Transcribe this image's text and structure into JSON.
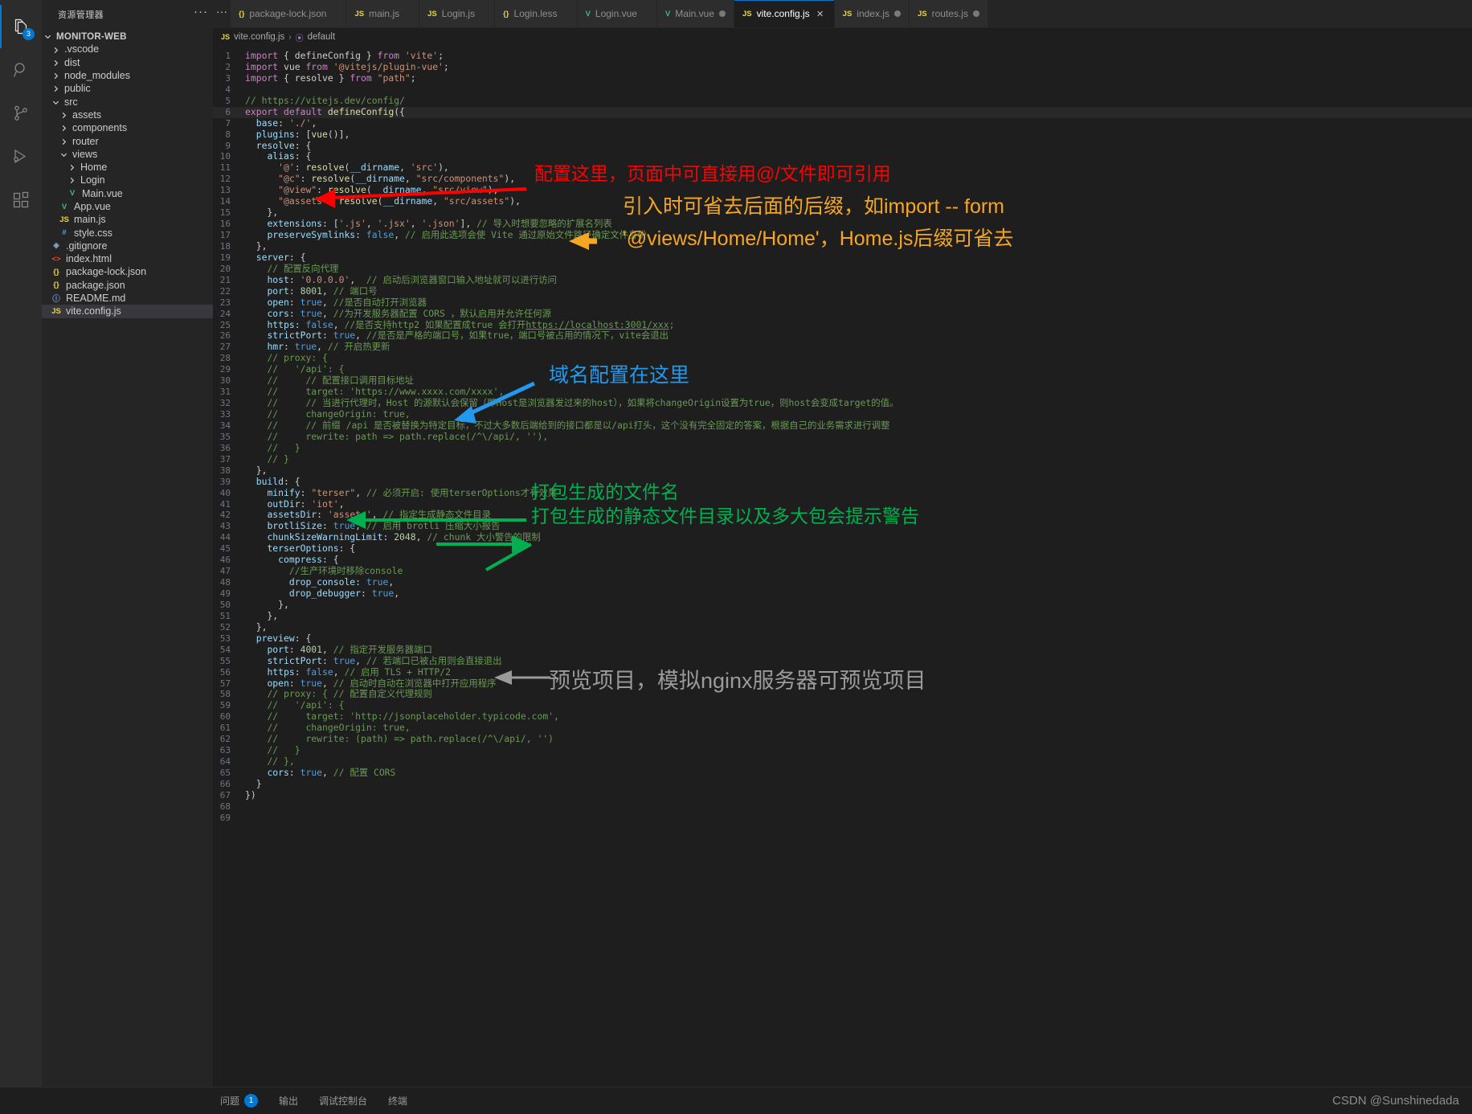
{
  "activitybar": {
    "items": [
      {
        "name": "explorer",
        "icon": "files-icon",
        "badge": "3",
        "active": true
      },
      {
        "name": "search",
        "icon": "search-icon",
        "badge": "",
        "active": false
      },
      {
        "name": "source-control",
        "icon": "source-control-icon",
        "badge": "",
        "active": false
      },
      {
        "name": "run-and-debug",
        "icon": "run-debug-icon",
        "badge": "",
        "active": false
      },
      {
        "name": "extensions",
        "icon": "extensions-icon",
        "badge": "",
        "active": false
      }
    ]
  },
  "sidebar": {
    "title": "资源管理器",
    "more_label": "···",
    "root": "MONITOR-WEB",
    "tree": [
      {
        "label": ".vscode",
        "indent": 1,
        "type": "folder",
        "open": false
      },
      {
        "label": "dist",
        "indent": 1,
        "type": "folder",
        "open": false
      },
      {
        "label": "node_modules",
        "indent": 1,
        "type": "folder",
        "open": false
      },
      {
        "label": "public",
        "indent": 1,
        "type": "folder",
        "open": false
      },
      {
        "label": "src",
        "indent": 1,
        "type": "folder",
        "open": true
      },
      {
        "label": "assets",
        "indent": 2,
        "type": "folder",
        "open": false
      },
      {
        "label": "components",
        "indent": 2,
        "type": "folder",
        "open": false
      },
      {
        "label": "router",
        "indent": 2,
        "type": "folder",
        "open": false
      },
      {
        "label": "views",
        "indent": 2,
        "type": "folder",
        "open": true
      },
      {
        "label": "Home",
        "indent": 3,
        "type": "folder",
        "open": false
      },
      {
        "label": "Login",
        "indent": 3,
        "type": "folder",
        "open": false
      },
      {
        "label": "Main.vue",
        "indent": 3,
        "type": "vue"
      },
      {
        "label": "App.vue",
        "indent": 2,
        "type": "vue"
      },
      {
        "label": "main.js",
        "indent": 2,
        "type": "js"
      },
      {
        "label": "style.css",
        "indent": 2,
        "type": "css"
      },
      {
        "label": ".gitignore",
        "indent": 1,
        "type": "git"
      },
      {
        "label": "index.html",
        "indent": 1,
        "type": "html"
      },
      {
        "label": "package-lock.json",
        "indent": 1,
        "type": "json"
      },
      {
        "label": "package.json",
        "indent": 1,
        "type": "json"
      },
      {
        "label": "README.md",
        "indent": 1,
        "type": "md"
      },
      {
        "label": "vite.config.js",
        "indent": 1,
        "type": "js",
        "selected": true
      }
    ]
  },
  "tabs": [
    {
      "label": "package-lock.json",
      "type": "json",
      "active": false,
      "dirty": false,
      "closeable": false
    },
    {
      "label": "main.js",
      "type": "js",
      "active": false,
      "dirty": false,
      "closeable": false
    },
    {
      "label": "Login.js",
      "type": "js",
      "active": false,
      "dirty": false,
      "closeable": false
    },
    {
      "label": "Login.less",
      "type": "json",
      "active": false,
      "dirty": false,
      "closeable": false
    },
    {
      "label": "Login.vue",
      "type": "vue",
      "active": false,
      "dirty": false,
      "closeable": false
    },
    {
      "label": "Main.vue",
      "type": "vue",
      "active": false,
      "dirty": true,
      "closeable": false
    },
    {
      "label": "vite.config.js",
      "type": "js",
      "active": true,
      "dirty": false,
      "closeable": true
    },
    {
      "label": "index.js",
      "type": "js",
      "active": false,
      "dirty": true,
      "closeable": false
    },
    {
      "label": "routes.js",
      "type": "js",
      "active": false,
      "dirty": true,
      "closeable": false
    }
  ],
  "breadcrumb": {
    "file": "vite.config.js",
    "separator": "›",
    "symbol": "default"
  },
  "editor": {
    "filename": "vite.config.js",
    "cursor_line": 6,
    "total_lines": 69,
    "lines": [
      {
        "n": 1,
        "text": "import { defineConfig } from 'vite';"
      },
      {
        "n": 2,
        "text": "import vue from '@vitejs/plugin-vue';"
      },
      {
        "n": 3,
        "text": "import { resolve } from \"path\";"
      },
      {
        "n": 4,
        "text": ""
      },
      {
        "n": 5,
        "text": "// https://vitejs.dev/config/"
      },
      {
        "n": 6,
        "text": "export default defineConfig({"
      },
      {
        "n": 7,
        "text": "  base: './',"
      },
      {
        "n": 8,
        "text": "  plugins: [vue()],"
      },
      {
        "n": 9,
        "text": "  resolve: {"
      },
      {
        "n": 10,
        "text": "    alias: {"
      },
      {
        "n": 11,
        "text": "      '@': resolve(__dirname, 'src'),"
      },
      {
        "n": 12,
        "text": "      \"@c\": resolve(__dirname, \"src/components\"),"
      },
      {
        "n": 13,
        "text": "      \"@view\": resolve(__dirname, \"src/view\"),"
      },
      {
        "n": 14,
        "text": "      \"@assets\": resolve(__dirname, \"src/assets\"),"
      },
      {
        "n": 15,
        "text": "    },"
      },
      {
        "n": 16,
        "text": "    extensions: ['.js', '.jsx', '.json'], // 导入时想要忽略的扩展名列表"
      },
      {
        "n": 17,
        "text": "    preserveSymlinks: false, // 启用此选项会使 Vite 通过原始文件路径确定文件身份"
      },
      {
        "n": 18,
        "text": "  },"
      },
      {
        "n": 19,
        "text": "  server: {"
      },
      {
        "n": 20,
        "text": "    // 配置反向代理"
      },
      {
        "n": 21,
        "text": "    host: '0.0.0.0',  // 启动后浏览器窗口输入地址就可以进行访问"
      },
      {
        "n": 22,
        "text": "    port: 8001, // 端口号"
      },
      {
        "n": 23,
        "text": "    open: true, //是否自动打开浏览器"
      },
      {
        "n": 24,
        "text": "    cors: true, //为开发服务器配置 CORS ，默认启用并允许任何源"
      },
      {
        "n": 25,
        "text": "    https: false, //是否支持http2 如果配置成true 会打开https://localhost:3001/xxx;"
      },
      {
        "n": 26,
        "text": "    strictPort: true, //是否是严格的端口号，如果true，端口号被占用的情况下，vite会退出"
      },
      {
        "n": 27,
        "text": "    hmr: true, // 开启热更新"
      },
      {
        "n": 28,
        "text": "    // proxy: {"
      },
      {
        "n": 29,
        "text": "    //   '/api': {"
      },
      {
        "n": 30,
        "text": "    //     // 配置接口调用目标地址"
      },
      {
        "n": 31,
        "text": "    //     target: 'https://www.xxxx.com/xxxx',"
      },
      {
        "n": 32,
        "text": "    //     // 当进行代理时，Host 的源默认会保留（即Host是浏览器发过来的host），如果将changeOrigin设置为true，则host会变成target的值。"
      },
      {
        "n": 33,
        "text": "    //     changeOrigin: true,"
      },
      {
        "n": 34,
        "text": "    //     // 前缀 /api 是否被替换为特定目标，不过大多数后端给到的接口都是以/api打头，这个没有完全固定的答案，根据自己的业务需求进行调整"
      },
      {
        "n": 35,
        "text": "    //     rewrite: path => path.replace(/^\\/api/, ''),"
      },
      {
        "n": 36,
        "text": "    //   }"
      },
      {
        "n": 37,
        "text": "    // }"
      },
      {
        "n": 38,
        "text": "  },"
      },
      {
        "n": 39,
        "text": "  build: {"
      },
      {
        "n": 40,
        "text": "    minify: \"terser\", // 必须开启: 使用terserOptions才有效果"
      },
      {
        "n": 41,
        "text": "    outDir: 'iot',"
      },
      {
        "n": 42,
        "text": "    assetsDir: 'assets', // 指定生成静态文件目录"
      },
      {
        "n": 43,
        "text": "    brotliSize: true, // 启用 brotli 压缩大小报告"
      },
      {
        "n": 44,
        "text": "    chunkSizeWarningLimit: 2048, // chunk 大小警告的限制"
      },
      {
        "n": 45,
        "text": "    terserOptions: {"
      },
      {
        "n": 46,
        "text": "      compress: {"
      },
      {
        "n": 47,
        "text": "        //生产环境时移除console"
      },
      {
        "n": 48,
        "text": "        drop_console: true,"
      },
      {
        "n": 49,
        "text": "        drop_debugger: true,"
      },
      {
        "n": 50,
        "text": "      },"
      },
      {
        "n": 51,
        "text": "    },"
      },
      {
        "n": 52,
        "text": "  },"
      },
      {
        "n": 53,
        "text": "  preview: {"
      },
      {
        "n": 54,
        "text": "    port: 4001, // 指定开发服务器端口"
      },
      {
        "n": 55,
        "text": "    strictPort: true, // 若端口已被占用则会直接退出"
      },
      {
        "n": 56,
        "text": "    https: false, // 启用 TLS + HTTP/2"
      },
      {
        "n": 57,
        "text": "    open: true, // 启动时自动在浏览器中打开应用程序"
      },
      {
        "n": 58,
        "text": "    // proxy: { // 配置自定义代理规则"
      },
      {
        "n": 59,
        "text": "    //   '/api': {"
      },
      {
        "n": 60,
        "text": "    //     target: 'http://jsonplaceholder.typicode.com',"
      },
      {
        "n": 61,
        "text": "    //     changeOrigin: true,"
      },
      {
        "n": 62,
        "text": "    //     rewrite: (path) => path.replace(/^\\/api/, '')"
      },
      {
        "n": 63,
        "text": "    //   }"
      },
      {
        "n": 64,
        "text": "    // },"
      },
      {
        "n": 65,
        "text": "    cors: true, // 配置 CORS"
      },
      {
        "n": 66,
        "text": "  }"
      },
      {
        "n": 67,
        "text": "})"
      },
      {
        "n": 68,
        "text": ""
      },
      {
        "n": 69,
        "text": ""
      }
    ]
  },
  "annotations": [
    {
      "id": "anno-alias",
      "color": "#ff0000",
      "text": "配置这里，页面中可直接用@/文件即可引用"
    },
    {
      "id": "anno-ext-1",
      "color": "#f5a623",
      "text": "引入时可省去后面的后缀，如import -- form"
    },
    {
      "id": "anno-ext-2",
      "color": "#f5a623",
      "text": "'@views/Home/Home'，Home.js后缀可省去"
    },
    {
      "id": "anno-proxy",
      "color": "#2299ee",
      "text": "域名配置在这里"
    },
    {
      "id": "anno-outdir",
      "color": "#00b050",
      "text": "打包生成的文件名"
    },
    {
      "id": "anno-assets",
      "color": "#00b050",
      "text": "打包生成的静态文件目录以及多大包会提示警告"
    },
    {
      "id": "anno-preview",
      "color": "#9a9a9a",
      "text": "预览项目，模拟nginx服务器可预览项目"
    }
  ],
  "panel": {
    "tabs": [
      {
        "label": "问题",
        "badge": "1",
        "active": false
      },
      {
        "label": "输出",
        "badge": "",
        "active": false
      },
      {
        "label": "调试控制台",
        "badge": "",
        "active": false
      },
      {
        "label": "终端",
        "badge": "",
        "active": false
      }
    ]
  },
  "watermark": "CSDN @Sunshinedada",
  "colors": {
    "accent": "#0078d4",
    "editor_bg": "#1e1e1e",
    "sidebar_bg": "#252526",
    "activitybar_bg": "#2c2c2c"
  }
}
